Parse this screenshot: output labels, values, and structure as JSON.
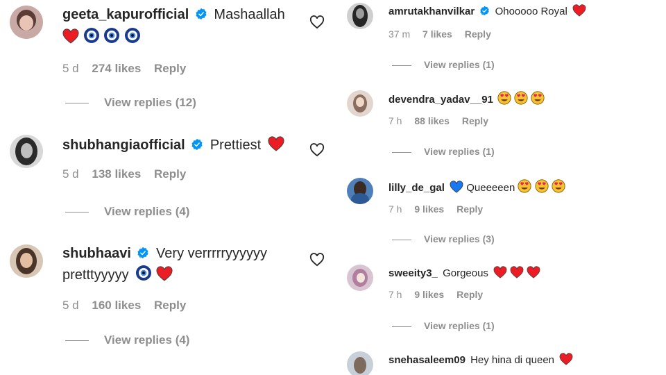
{
  "left_comments": [
    {
      "username": "geeta_kapurofficial",
      "verified": true,
      "text": "Mashaallah",
      "age": "5 d",
      "likes": "274 likes",
      "reply": "Reply",
      "view_replies": "View replies (12)"
    },
    {
      "username": "shubhangiaofficial",
      "verified": true,
      "text": "Prettiest",
      "age": "5 d",
      "likes": "138 likes",
      "reply": "Reply",
      "view_replies": "View replies (4)"
    },
    {
      "username": "shubhaavi",
      "verified": true,
      "text_line1": "Very verrrrryyyyyy",
      "text_line2": "pretttyyyyy",
      "age": "5 d",
      "likes": "160 likes",
      "reply": "Reply",
      "view_replies": "View replies (4)"
    }
  ],
  "right_comments": [
    {
      "username": "amrutakhanvilkar",
      "verified": true,
      "text": "Ohooooo Royal",
      "age": "37 m",
      "likes": "7 likes",
      "reply": "Reply",
      "view_replies": "View replies (1)"
    },
    {
      "username": "devendra_yadav__91",
      "verified": false,
      "text": "",
      "age": "7 h",
      "likes": "88 likes",
      "reply": "Reply",
      "view_replies": "View replies (1)"
    },
    {
      "username": "lilly_de_gal",
      "verified": false,
      "text": "Queeeeen",
      "age": "7 h",
      "likes": "9 likes",
      "reply": "Reply",
      "view_replies": "View replies (3)"
    },
    {
      "username": "sweeity3_",
      "verified": false,
      "text": "Gorgeous",
      "age": "7 h",
      "likes": "9 likes",
      "reply": "Reply",
      "view_replies": "View replies (1)"
    },
    {
      "username": "snehasaleem09",
      "verified": false,
      "text": "Hey hina di queen"
    }
  ],
  "colors": {
    "text": "#262626",
    "muted": "#8e8e8e",
    "verified_blue": "#0095f6",
    "heart_red": "#ed1c24",
    "heart_blue": "#1877f2",
    "nazar_blue": "#1b3a8c"
  },
  "icons": [
    "verified-badge-icon",
    "like-heart-icon",
    "red-heart-emoji",
    "blue-heart-emoji",
    "nazar-amulet-emoji",
    "heart-eyes-emoji"
  ]
}
